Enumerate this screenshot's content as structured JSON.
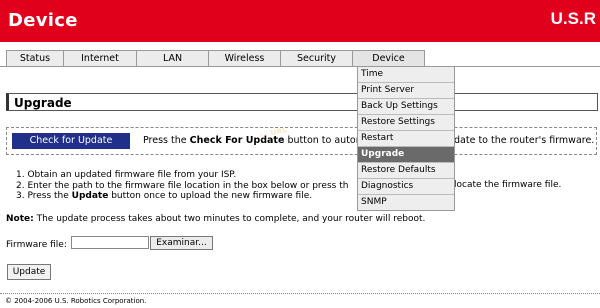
{
  "header": {
    "title": "Device",
    "logo": "U.S.R"
  },
  "tabs": [
    "Status",
    "Internet",
    "LAN",
    "Wireless",
    "Security",
    "Device"
  ],
  "dropdown": {
    "items": [
      "Time",
      "Print Server",
      "Back Up Settings",
      "Restore Settings",
      "Restart",
      "Upgrade",
      "Restore Defaults",
      "Diagnostics",
      "SNMP"
    ],
    "active": "Upgrade"
  },
  "page": {
    "title": "Upgrade"
  },
  "check": {
    "button": "Check for Update",
    "text_pre": "Press the ",
    "text_bold": "Check For Update",
    "text_post": " button to automa",
    "text_right": "date to the router's firmware."
  },
  "steps": [
    "1.  Obtain an updated firmware file from your ISP.",
    "2.  Enter the path to the firmware file location in the box below or press th",
    "3.  Press the "
  ],
  "step3_bold": "Update",
  "step3_post": " button once to upload the new firmware file.",
  "step2_right": "locate the firmware file.",
  "note": {
    "label": "Note:",
    "text": " The update process takes about two minutes to complete, and your router will reboot."
  },
  "firmware": {
    "label": "Firmware file:",
    "browse": "Examinar..."
  },
  "update_button": "Update",
  "footer": "© 2004-2006 U.S. Robotics Corporation."
}
